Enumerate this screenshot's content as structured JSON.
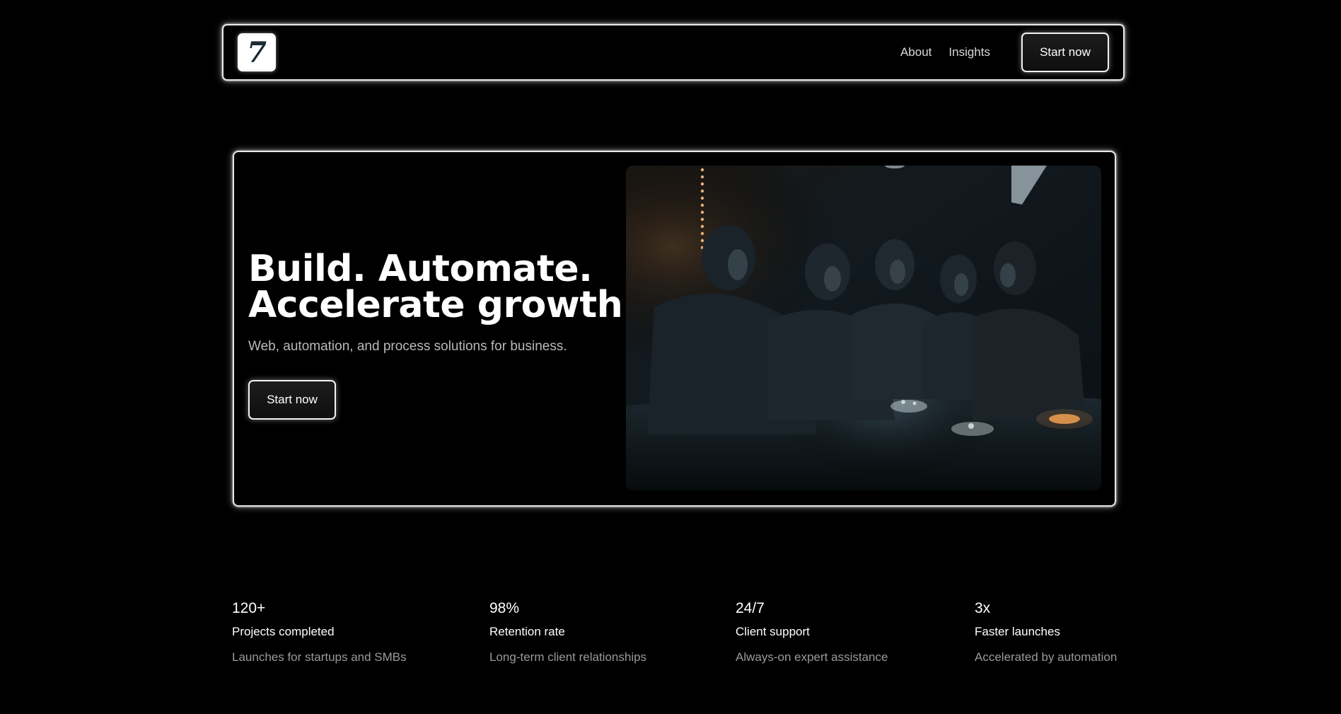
{
  "nav": {
    "logo_letter": "7",
    "links": [
      {
        "label": "About"
      },
      {
        "label": "Insights"
      }
    ],
    "cta_label": "Start now"
  },
  "hero": {
    "title_line_1": "Build. Automate.",
    "title_line_2": "Accelerate growth.",
    "subtitle": "Web, automation, and process solutions for business.",
    "cta_label": "Start now",
    "image_alt": "team-meeting-photo"
  },
  "stats": [
    {
      "value": "120+",
      "label": "Projects completed",
      "description": "Launches for startups and SMBs"
    },
    {
      "value": "98%",
      "label": "Retention rate",
      "description": "Long-term client relationships"
    },
    {
      "value": "24/7",
      "label": "Client support",
      "description": "Always-on expert assistance"
    },
    {
      "value": "3x",
      "label": "Faster launches",
      "description": "Accelerated by automation"
    }
  ],
  "colors": {
    "background": "#000000",
    "border_glow": "#e9e9e9",
    "text_primary": "#ffffff",
    "text_secondary": "#b9b9b9",
    "text_muted": "#9a9a9a",
    "logo_glyph": "#1b2a33"
  }
}
